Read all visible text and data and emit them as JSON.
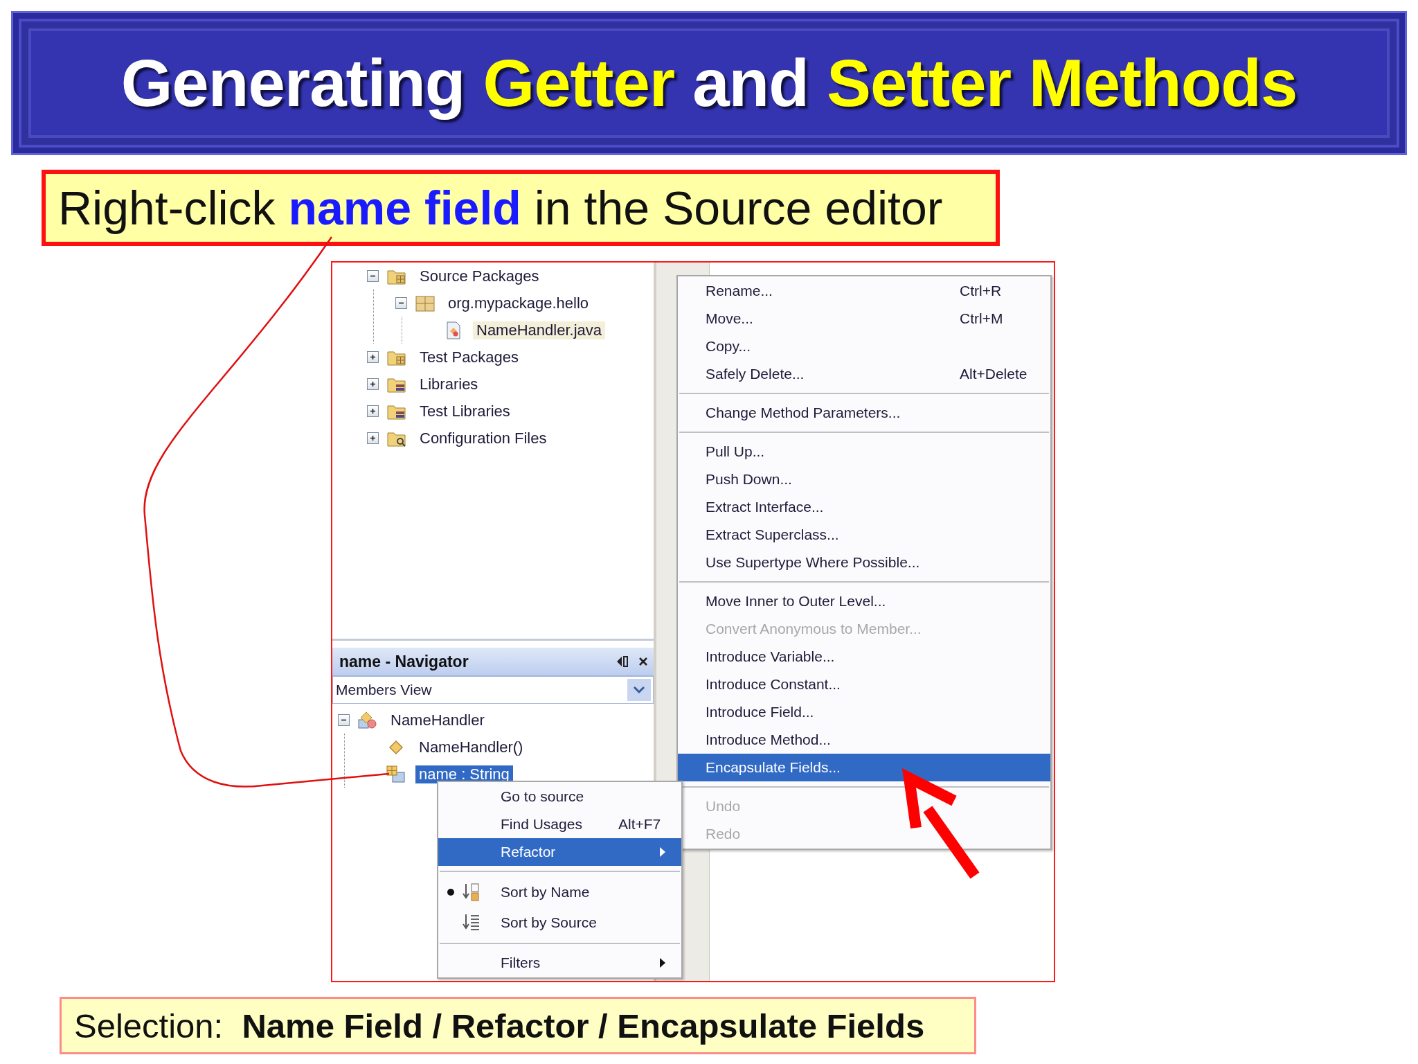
{
  "title": [
    {
      "text": "Generating",
      "highlight": false
    },
    {
      "text": "Getter",
      "highlight": true
    },
    {
      "text": "and",
      "highlight": false
    },
    {
      "text": "Setter Methods",
      "highlight": true
    }
  ],
  "instruction": "Right-click **name field** in the Source editor",
  "project_tree": {
    "items": [
      {
        "label": "Source Packages",
        "kind": "source-folder",
        "expanded": true,
        "selected": false,
        "children": [
          {
            "label": "org.mypackage.hello",
            "kind": "package",
            "expanded": true,
            "selected": false,
            "children": [
              {
                "label": "NameHandler.java",
                "kind": "java-file",
                "selected": true
              }
            ]
          }
        ]
      },
      {
        "label": "Test Packages",
        "kind": "source-folder",
        "expanded": false,
        "selected": false
      },
      {
        "label": "Libraries",
        "kind": "library-folder",
        "expanded": false,
        "selected": false
      },
      {
        "label": "Test Libraries",
        "kind": "library-folder",
        "expanded": false,
        "selected": false
      },
      {
        "label": "Configuration Files",
        "kind": "config-folder",
        "expanded": false,
        "selected": false
      }
    ]
  },
  "navigator": {
    "title": "name - Navigator",
    "view": "Members View",
    "items": [
      {
        "label": "NameHandler",
        "kind": "class",
        "expanded": true,
        "selected": false,
        "children": [
          {
            "label": "NameHandler()",
            "kind": "constructor",
            "selected": false
          },
          {
            "label": "name : String",
            "kind": "field",
            "selected": true
          }
        ]
      }
    ]
  },
  "context_menu": {
    "groups": [
      {
        "items": [
          {
            "label": "Go to source",
            "selected": false,
            "submenu": false
          },
          {
            "label": "Find Usages",
            "shortcut": "Alt+F7",
            "selected": false,
            "submenu": false
          },
          {
            "label": "Refactor",
            "selected": true,
            "submenu": true
          }
        ]
      },
      {
        "items": [
          {
            "label": "Sort by Name",
            "kind": "sort-name",
            "checked": true,
            "selected": false,
            "submenu": false
          },
          {
            "label": "Sort by Source",
            "kind": "sort-source",
            "checked": false,
            "selected": false,
            "submenu": false
          }
        ]
      },
      {
        "items": [
          {
            "label": "Filters",
            "selected": false,
            "submenu": true
          }
        ]
      }
    ]
  },
  "refactor_menu": {
    "groups": [
      {
        "items": [
          {
            "label": "Rename...",
            "shortcut": "Ctrl+R",
            "disabled": false,
            "selected": false
          },
          {
            "label": "Move...",
            "shortcut": "Ctrl+M",
            "disabled": false,
            "selected": false
          },
          {
            "label": "Copy...",
            "disabled": false,
            "selected": false
          },
          {
            "label": "Safely Delete...",
            "shortcut": "Alt+Delete",
            "disabled": false,
            "selected": false
          }
        ]
      },
      {
        "items": [
          {
            "label": "Change Method Parameters...",
            "disabled": false,
            "selected": false
          }
        ]
      },
      {
        "items": [
          {
            "label": "Pull Up...",
            "disabled": false,
            "selected": false
          },
          {
            "label": "Push Down...",
            "disabled": false,
            "selected": false
          },
          {
            "label": "Extract Interface...",
            "disabled": false,
            "selected": false
          },
          {
            "label": "Extract Superclass...",
            "disabled": false,
            "selected": false
          },
          {
            "label": "Use Supertype Where Possible...",
            "disabled": false,
            "selected": false
          }
        ]
      },
      {
        "items": [
          {
            "label": "Move Inner to Outer Level...",
            "disabled": false,
            "selected": false
          },
          {
            "label": "Convert Anonymous to Member...",
            "disabled": true,
            "selected": false
          },
          {
            "label": "Introduce Variable...",
            "disabled": false,
            "selected": false
          },
          {
            "label": "Introduce Constant...",
            "disabled": false,
            "selected": false
          },
          {
            "label": "Introduce Field...",
            "disabled": false,
            "selected": false
          },
          {
            "label": "Introduce Method...",
            "disabled": false,
            "selected": false
          },
          {
            "label": "Encapsulate Fields...",
            "disabled": false,
            "selected": true
          }
        ]
      },
      {
        "items": [
          {
            "label": "Undo",
            "disabled": true,
            "selected": false
          },
          {
            "label": "Redo",
            "disabled": true,
            "selected": false
          }
        ]
      }
    ]
  },
  "selection": "Selection:  **Name Field / Refactor / Encapsulate Fields**"
}
